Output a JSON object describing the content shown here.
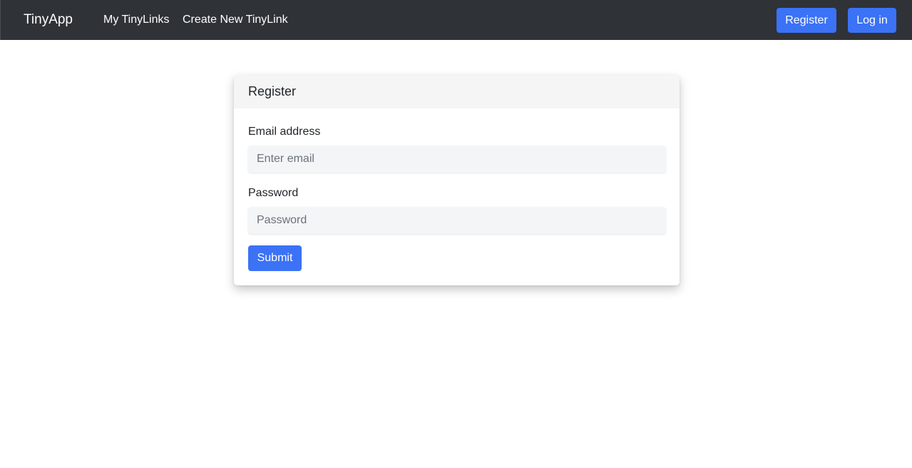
{
  "navbar": {
    "brand": "TinyApp",
    "links": [
      "My TinyLinks",
      "Create New TinyLink"
    ],
    "register_label": "Register",
    "login_label": "Log in"
  },
  "card": {
    "title": "Register",
    "email_label": "Email address",
    "email_placeholder": "Enter email",
    "email_value": "",
    "password_label": "Password",
    "password_placeholder": "Password",
    "password_value": "",
    "submit_label": "Submit"
  },
  "colors": {
    "navbar_bg": "#2f3237",
    "primary": "#3b72f6",
    "card_header_bg": "#f5f5f5",
    "input_bg": "#f4f5f7"
  }
}
